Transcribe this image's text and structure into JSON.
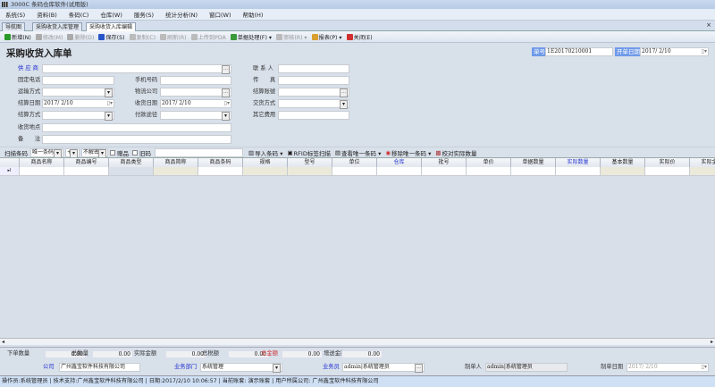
{
  "window": {
    "title": "3000C 条码仓库软件(试用版)"
  },
  "menu": [
    "系统(S)",
    "资料(B)",
    "条码(C)",
    "仓库(W)",
    "服务(S)",
    "统计分析(N)",
    "窗口(W)",
    "帮助(H)"
  ],
  "tabs": [
    "导航图",
    "采购收货入库管理",
    "采购收货入库编辑"
  ],
  "toolbar": [
    {
      "label": "新增(N)",
      "icon": "plus-icon",
      "color": "#2a9a2a",
      "enabled": true
    },
    {
      "label": "修改(M)",
      "icon": "pencil-icon",
      "color": "#aaa",
      "enabled": false
    },
    {
      "label": "删除(D)",
      "icon": "x-icon",
      "color": "#aaa",
      "enabled": false
    },
    {
      "label": "保存(S)",
      "icon": "save-icon",
      "color": "#2856c8",
      "enabled": true
    },
    {
      "label": "复制(C)",
      "icon": "copy-icon",
      "color": "#bbb",
      "enabled": false
    },
    {
      "label": "刷新(R)",
      "icon": "refresh-icon",
      "color": "#bbb",
      "enabled": false
    },
    {
      "label": "上传到PDA",
      "icon": "upload-icon",
      "color": "#bbb",
      "enabled": false
    },
    {
      "label": "单据处理(F) ▾",
      "icon": "process-icon",
      "color": "#3a9a3a",
      "enabled": true
    },
    {
      "label": "审核(R) ▾",
      "icon": "audit-icon",
      "color": "#bbb",
      "enabled": false
    },
    {
      "label": "报表(P) ▾",
      "icon": "report-icon",
      "color": "#d9a030",
      "enabled": true
    },
    {
      "label": "关闭(E)",
      "icon": "close-icon",
      "color": "#d03030",
      "enabled": true
    }
  ],
  "form": {
    "heading": "采购收货入库单",
    "order_no_label": "单号",
    "order_no": "1E20170210001",
    "open_date_label": "开单日期",
    "open_date": "2017/ 2/10",
    "supplier": "供 应 商",
    "contact": "联 系 人",
    "phone": "固定电话",
    "mobile": "手机号码",
    "fax": "传　　真",
    "transport": "运输方式",
    "logistics": "物流公司",
    "settle_account": "结算账號",
    "settle_date": "结算日期",
    "settle_date_value": "2017/ 2/10",
    "receive_date": "收货日期",
    "receive_date_value": "2017/ 2/10",
    "trade_method": "交货方式",
    "settle_method": "结算方式",
    "pay_channel": "付款途径",
    "other_fee": "其它费用",
    "address": "收货地点",
    "remark": "备　　注"
  },
  "scan": {
    "label": "扫描条码",
    "mode": "唯一条码",
    "sign": "+",
    "decrypt": "不解密",
    "gift": "赠品",
    "return": "旧码",
    "import": "导入条码 ▾",
    "rfid": "RFID标签扫描",
    "view": "查看唯一条码 ▾",
    "remove": "移除唯一条码 ▾",
    "check": "校对实际数量"
  },
  "grid": {
    "columns": [
      "商品名称",
      "商品编号",
      "商品类型",
      "商品简称",
      "商品条码",
      "规格",
      "型号",
      "单位",
      "仓库",
      "批号",
      "单价",
      "单据数量",
      "实际数量",
      "基本数量",
      "实际价",
      "实际金额"
    ],
    "blue_columns": [
      "仓库",
      "实际数量"
    ],
    "row_marker": "▸I"
  },
  "summary": {
    "items": [
      {
        "label": "下单数量",
        "value": "0.00"
      },
      {
        "label": "总数量",
        "value": "0.00"
      },
      {
        "label": "实际金额",
        "value": "0.00"
      },
      {
        "label": "总税额",
        "value": "0.00"
      },
      {
        "label": "总金额",
        "value": "0.00"
      },
      {
        "label": "增送金额",
        "value": "0.00"
      }
    ],
    "company_label": "公司",
    "company": "广州鑫宝软件科技有限公司",
    "dept_label": "业务部门",
    "dept": "系统管理",
    "clerk_label": "业务员",
    "clerk": "admin|系统管理员",
    "maker_label": "制单人",
    "maker": "admin|系统管理员",
    "make_date_label": "制单日期",
    "make_date": "2017/ 2/10"
  },
  "status": "操作员:系统管理员  |  技术支持:广州鑫宝软件科技有限公司  |  日期:2017/2/10 10:06:57  |  当前账套: 演示账套  |  用户所属公司: 广州鑫宝软件科技有限公司"
}
